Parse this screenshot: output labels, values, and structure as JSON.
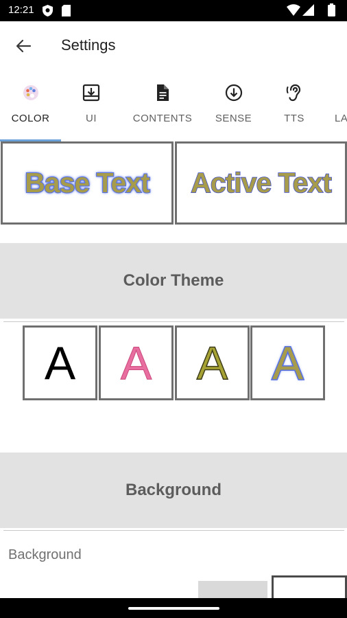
{
  "status_bar": {
    "time": "12:21",
    "icons": [
      "shield-icon",
      "sd-card-icon",
      "wifi-icon",
      "signal-icon",
      "battery-icon"
    ]
  },
  "app_bar": {
    "title": "Settings",
    "back_icon": "arrow-left-icon"
  },
  "tabs": [
    {
      "label": "COLOR",
      "icon": "palette-icon",
      "active": true
    },
    {
      "label": "UI",
      "icon": "download-box-icon",
      "active": false
    },
    {
      "label": "CONTENTS",
      "icon": "document-icon",
      "active": false
    },
    {
      "label": "SENSE",
      "icon": "arrow-down-circle-icon",
      "active": false
    },
    {
      "label": "TTS",
      "icon": "ear-icon",
      "active": false
    },
    {
      "label": "LA",
      "icon": "",
      "active": false
    }
  ],
  "preview": {
    "base_text": "Base Text",
    "active_text": "Active Text"
  },
  "color_theme": {
    "title": "Color Theme",
    "swatches": [
      {
        "letter": "A",
        "fill": "#000000",
        "outline": "none"
      },
      {
        "letter": "A",
        "fill": "#e96ea0",
        "outline": "#c9477c"
      },
      {
        "letter": "A",
        "fill": "#a6a233",
        "outline": "#3c3c1a"
      },
      {
        "letter": "A",
        "fill": "#a79b4c",
        "outline": "#5570e6"
      }
    ]
  },
  "background": {
    "title": "Background",
    "label": "Background"
  },
  "colors": {
    "accent": "#6aa1d8",
    "section_bg": "#e2e2e2",
    "text_fill": "#a79b4c",
    "text_outline": "#5570e6"
  }
}
